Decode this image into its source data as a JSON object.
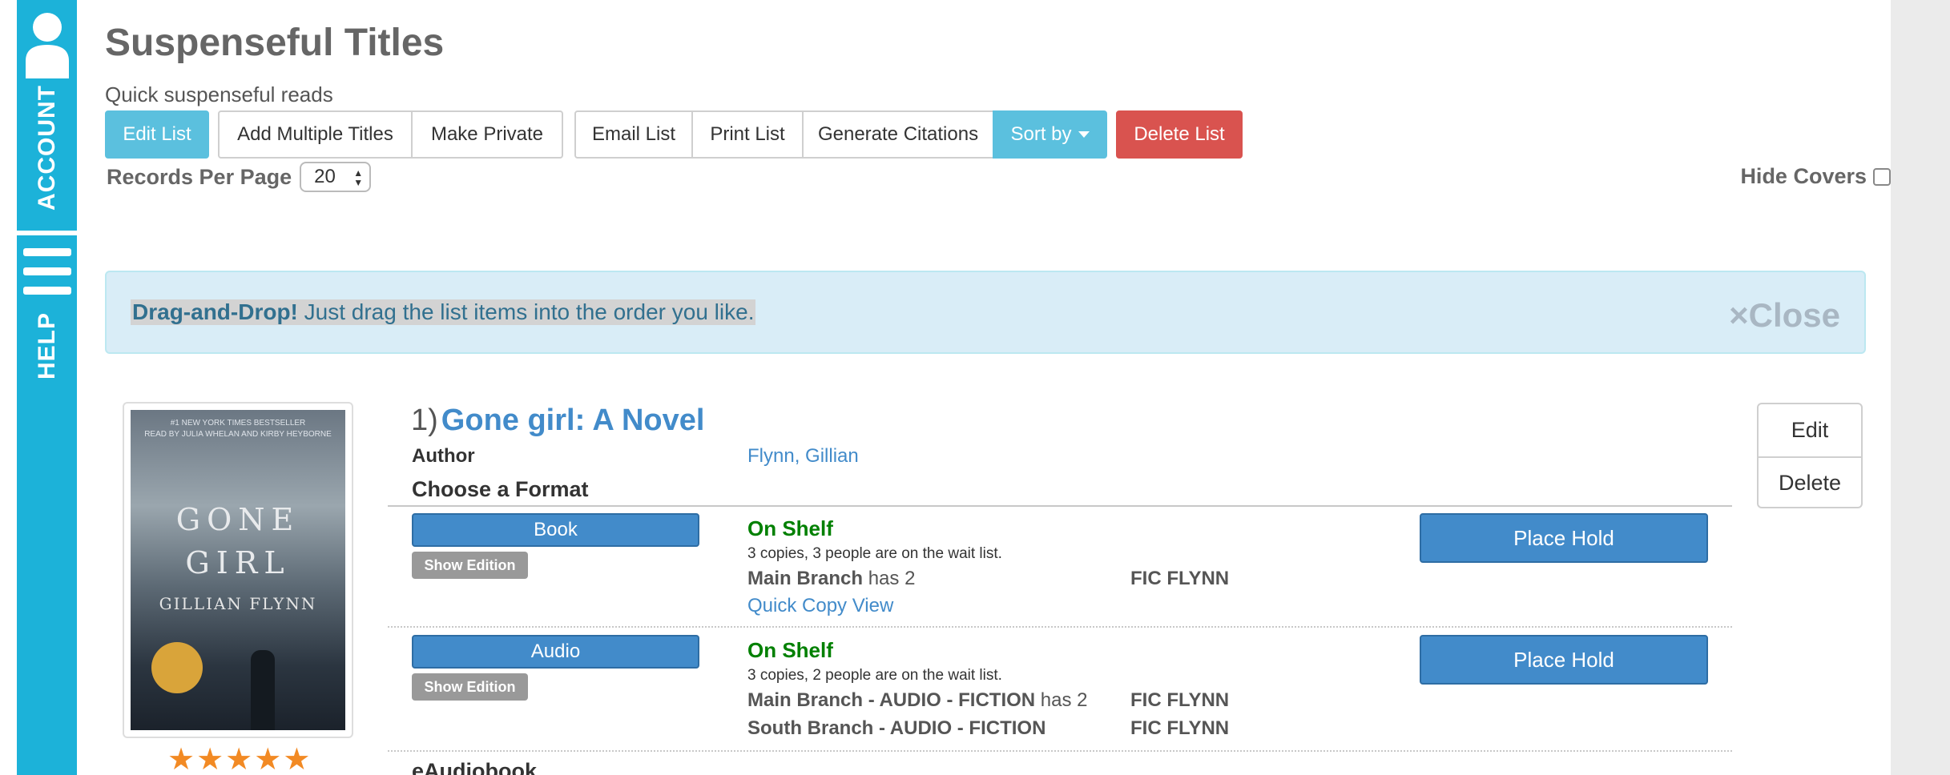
{
  "side_tabs": {
    "account_label": "ACCOUNT",
    "help_label": "HELP"
  },
  "list": {
    "title": "Suspenseful Titles",
    "description": "Quick suspenseful reads"
  },
  "toolbar": {
    "edit_list": "Edit List",
    "add_multiple_titles": "Add Multiple Titles",
    "make_private": "Make Private",
    "email_list": "Email List",
    "print_list": "Print List",
    "generate_citations": "Generate Citations",
    "sort_by": "Sort by",
    "delete_list": "Delete List"
  },
  "records_per_page": {
    "label": "Records Per Page",
    "value": "20"
  },
  "hide_covers": {
    "label": "Hide Covers",
    "checked": false
  },
  "alert": {
    "strong": "Drag-and-Drop!",
    "text": " Just drag the list items into the order you like.",
    "close": "×Close"
  },
  "item": {
    "number": "1)",
    "title": "Gone girl: A Novel",
    "author_label": "Author",
    "author": "Flynn, Gillian",
    "choose_format": "Choose a Format",
    "edit": "Edit",
    "delete": "Delete",
    "rating": 5,
    "cover": {
      "top_line1": "#1 NEW YORK TIMES BESTSELLER",
      "top_line2": "READ BY JULIA WHELAN AND KIRBY HEYBORNE",
      "title_line1": "GONE",
      "title_line2": "GIRL",
      "author": "GILLIAN FLYNN"
    },
    "formats": [
      {
        "name": "Book",
        "show_edition": "Show Edition",
        "status": "On Shelf",
        "copies": "3 copies, 3 people are on the wait list.",
        "locations": [
          {
            "name": "Main Branch",
            "suffix": " has 2",
            "call_number": "FIC FLYNN"
          }
        ],
        "quick_copy": "Quick Copy View",
        "place_hold": "Place Hold"
      },
      {
        "name": "Audio",
        "show_edition": "Show Edition",
        "status": "On Shelf",
        "copies": "3 copies, 2 people are on the wait list.",
        "locations": [
          {
            "name": "Main Branch - AUDIO - FICTION",
            "suffix": " has 2",
            "call_number": "FIC FLYNN"
          },
          {
            "name": "South Branch - AUDIO - FICTION",
            "suffix": "",
            "call_number": "FIC FLYNN"
          }
        ],
        "place_hold": "Place Hold"
      }
    ],
    "next_format": "eAudiobook"
  },
  "colors": {
    "side_tab": "#1cb2d9",
    "primary": "#428bca",
    "info": "#5bc0de",
    "danger": "#d9534f",
    "success_text": "#008000",
    "alert_bg": "#d9edf7"
  }
}
